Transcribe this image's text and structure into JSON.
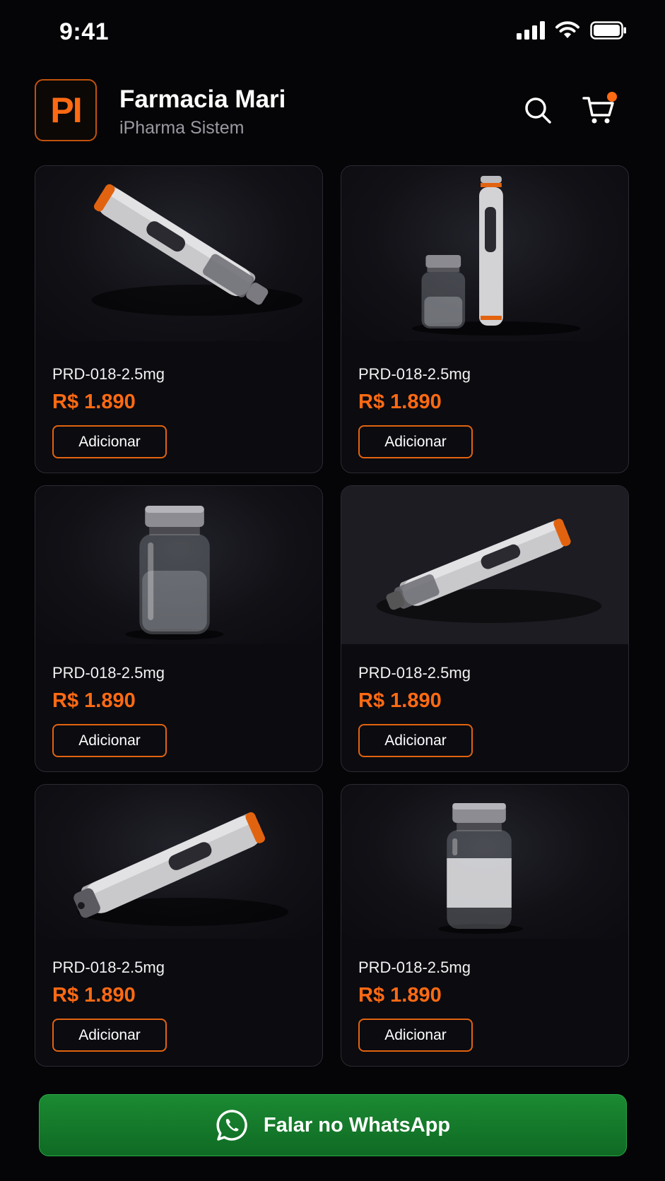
{
  "status_bar": {
    "time": "9:41",
    "icons": [
      "signal-icon",
      "wifi-icon",
      "battery-icon"
    ]
  },
  "header": {
    "logo_text": "PI",
    "store_name": "Farmacia Mari",
    "subtitle": "iPharma Sistem",
    "search_icon": "search-icon",
    "cart_icon": "cart-icon"
  },
  "colors": {
    "accent": "#ff6a13",
    "background": "#050507",
    "card_border": "#2b2b33",
    "whatsapp_green": "#1b8a32"
  },
  "products": [
    {
      "image": "pen-diagonal",
      "sku": "PRD-018-2.5mg",
      "price": "R$ 1.890",
      "button": "Adicionar"
    },
    {
      "image": "vial-and-pen",
      "sku": "PRD-018-2.5mg",
      "price": "R$ 1.890",
      "button": "Adicionar"
    },
    {
      "image": "vial",
      "sku": "PRD-018-2.5mg",
      "price": "R$ 1.890",
      "button": "Adicionar"
    },
    {
      "image": "pen-reversed",
      "sku": "PRD-018-2.5mg",
      "price": "R$ 1.890",
      "button": "Adicionar"
    },
    {
      "image": "pen-tilted",
      "sku": "PRD-018-2.5mg",
      "price": "R$ 1.890",
      "button": "Adicionar"
    },
    {
      "image": "vial-labeled",
      "sku": "PRD-018-2.5mg",
      "price": "R$ 1.890",
      "button": "Adicionar"
    }
  ],
  "whatsapp": {
    "label": "Falar no WhatsApp",
    "icon": "whatsapp-icon"
  }
}
